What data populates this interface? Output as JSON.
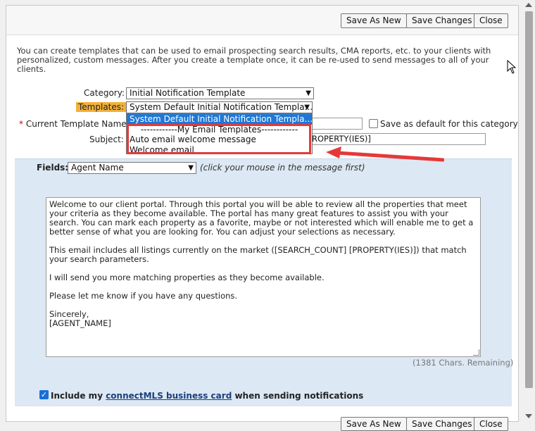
{
  "toolbar": {
    "save_as_new": "Save As New",
    "save_changes": "Save Changes",
    "close": "Close"
  },
  "intro_text": "You can create templates that can be used to email prospecting search results, CMA reports, etc. to your clients with personalized, custom messages. After you create a template once, it can be re-used to send messages to all of your clients.",
  "form": {
    "category_label": "Category:",
    "category_value": "Initial Notification Template",
    "templates_label": "Templates:",
    "templates_value": "System Default Initial Notification Templa...",
    "required_mark": "*",
    "template_name_label": "Current Template Name:",
    "template_name_value": "",
    "save_default_label": "Save as default for this category",
    "subject_label": "Subject:",
    "subject_value": "ROPERTY(IES)]"
  },
  "dropdown": {
    "options": [
      "System Default Initial Notification Templa...",
      "------------My Email Templates------------",
      "Auto email welcome message",
      "Welcome email"
    ]
  },
  "fields": {
    "label": "Fields:",
    "value": "Agent Name",
    "hint": "(click your mouse in the message first)"
  },
  "message": {
    "paragraphs": [
      "Welcome to our client portal.   Through this portal you will be able to review all the properties that meet your criteria as they become available.  The portal has many great features to assist you with your search.  You can mark each property as a favorite, maybe or not interested which will enable me to get a better sense of what you are looking for.  You can adjust your selections as necessary.",
      "This email includes all listings currently on the market ([SEARCH_COUNT] [PROPERTY(IES)]) that match your search parameters.",
      "I will send you more matching properties as they become available.",
      "Please let me know if you have any questions."
    ],
    "signoff": "Sincerely,",
    "signature": "[AGENT_NAME]",
    "remaining": "(1381 Chars. Remaining)"
  },
  "include": {
    "prefix": "Include my ",
    "link": "connectMLS business card",
    "suffix": " when sending notifications"
  },
  "colors": {
    "panel": "#dce8f4",
    "highlight": "#e53939",
    "selected_option": "#1e78d7",
    "templates_label_bg": "#f2b13a"
  }
}
